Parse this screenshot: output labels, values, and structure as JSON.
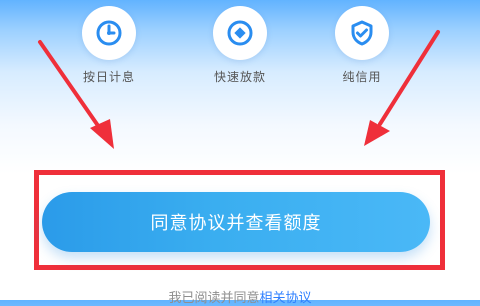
{
  "features": [
    {
      "label": "按日计息",
      "icon": "clock-icon"
    },
    {
      "label": "快速放款",
      "icon": "coin-icon"
    },
    {
      "label": "纯信用",
      "icon": "shield-check-icon"
    }
  ],
  "cta": {
    "label": "同意协议并查看额度"
  },
  "agreement": {
    "prefix": "我已阅读并同意",
    "link": "相关协议"
  },
  "colors": {
    "accent": "#2f80ff",
    "button": "#3aaef0",
    "highlight": "#ef2f3a"
  }
}
